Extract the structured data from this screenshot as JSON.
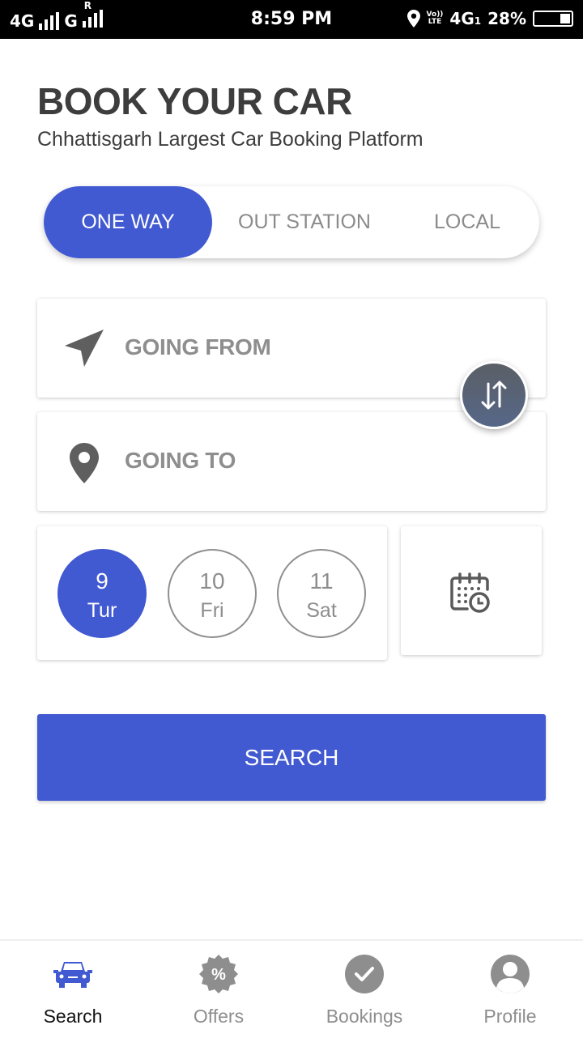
{
  "status_bar": {
    "network_left": "4G",
    "network_second": "G",
    "roaming": "R",
    "time": "8:59 PM",
    "volte": "Vo))",
    "lte": "LTE",
    "network_right": "4G",
    "sim_index": "1",
    "battery_percent": "28%",
    "battery_level": 0.28
  },
  "header": {
    "title": "BOOK YOUR CAR",
    "subtitle": "Chhattisgarh Largest Car Booking Platform"
  },
  "trip_types": [
    {
      "label": "ONE WAY",
      "active": true
    },
    {
      "label": "OUT STATION",
      "active": false
    },
    {
      "label": "LOCAL",
      "active": false
    }
  ],
  "location": {
    "from_placeholder": "GOING FROM",
    "to_placeholder": "GOING TO"
  },
  "dates": [
    {
      "day": "9",
      "weekday": "Tur",
      "active": true
    },
    {
      "day": "10",
      "weekday": "Fri",
      "active": false
    },
    {
      "day": "11",
      "weekday": "Sat",
      "active": false
    }
  ],
  "search_label": "SEARCH",
  "colors": {
    "accent": "#4159d1",
    "inactive": "#8e8e8e",
    "title": "#3d3d3d"
  },
  "bottom_nav": [
    {
      "label": "Search",
      "icon": "car-icon",
      "active": true
    },
    {
      "label": "Offers",
      "icon": "offer-badge-icon",
      "active": false
    },
    {
      "label": "Bookings",
      "icon": "check-circle-icon",
      "active": false
    },
    {
      "label": "Profile",
      "icon": "profile-icon",
      "active": false
    }
  ]
}
